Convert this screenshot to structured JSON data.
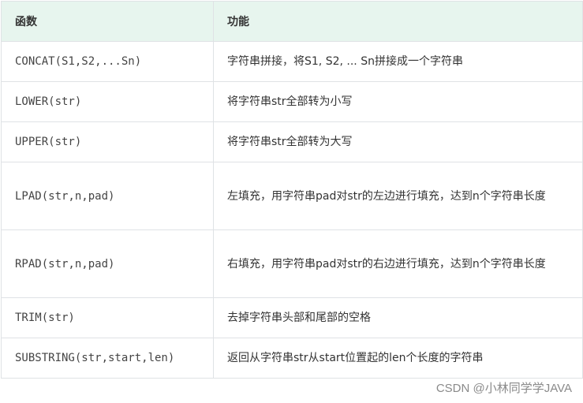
{
  "table": {
    "headers": {
      "function": "函数",
      "feature": "功能"
    },
    "rows": [
      {
        "function": "CONCAT(S1,S2,...Sn)",
        "description": "字符串拼接，将S1, S2, ... Sn拼接成一个字符串"
      },
      {
        "function": "LOWER(str)",
        "description": "将字符串str全部转为小写"
      },
      {
        "function": "UPPER(str)",
        "description": "将字符串str全部转为大写"
      },
      {
        "function": "LPAD(str,n,pad)",
        "description": "左填充，用字符串pad对str的左边进行填充，达到n个字符串长度"
      },
      {
        "function": "RPAD(str,n,pad)",
        "description": "右填充，用字符串pad对str的右边进行填充，达到n个字符串长度"
      },
      {
        "function": "TRIM(str)",
        "description": "去掉字符串头部和尾部的空格"
      },
      {
        "function": "SUBSTRING(str,start,len)",
        "description": "返回从字符串str从start位置起的len个长度的字符串"
      }
    ]
  },
  "watermark": "CSDN @小林同学学JAVA",
  "colors": {
    "header_bg": "#e7f5ee",
    "border": "#dfe2e5",
    "watermark": "#8a8a8a"
  }
}
